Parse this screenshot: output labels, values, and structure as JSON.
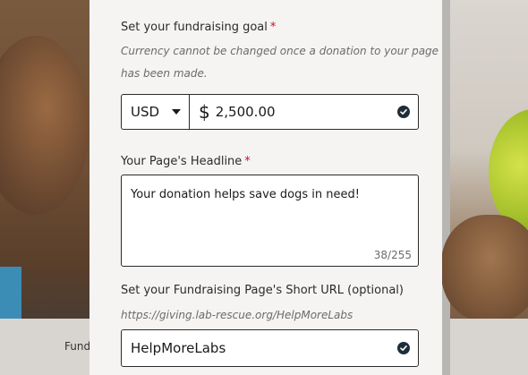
{
  "background": {
    "partial_text": "Fund"
  },
  "goal": {
    "label": "Set your fundraising goal",
    "required_mark": "*",
    "help_line1": "Currency cannot be changed once a donation to your page",
    "help_line2": "has been made.",
    "currency": "USD",
    "currency_symbol": "$",
    "amount": "2,500.00",
    "valid_icon": "check-circle-icon"
  },
  "headline": {
    "label": "Your Page's Headline",
    "required_mark": "*",
    "value": "Your donation helps save dogs in need!",
    "counter": "38/255"
  },
  "short_url": {
    "label": "Set your Fundraising Page's Short URL (optional)",
    "preview": "https://giving.lab-rescue.org/HelpMoreLabs",
    "value": "HelpMoreLabs",
    "valid_icon": "check-circle-icon"
  },
  "colors": {
    "required": "#c8102e",
    "text": "#2b2b2b",
    "muted": "#6b6b6b",
    "check_icon": "#1f2d3a",
    "panel_bg": "#f5f4f3"
  }
}
